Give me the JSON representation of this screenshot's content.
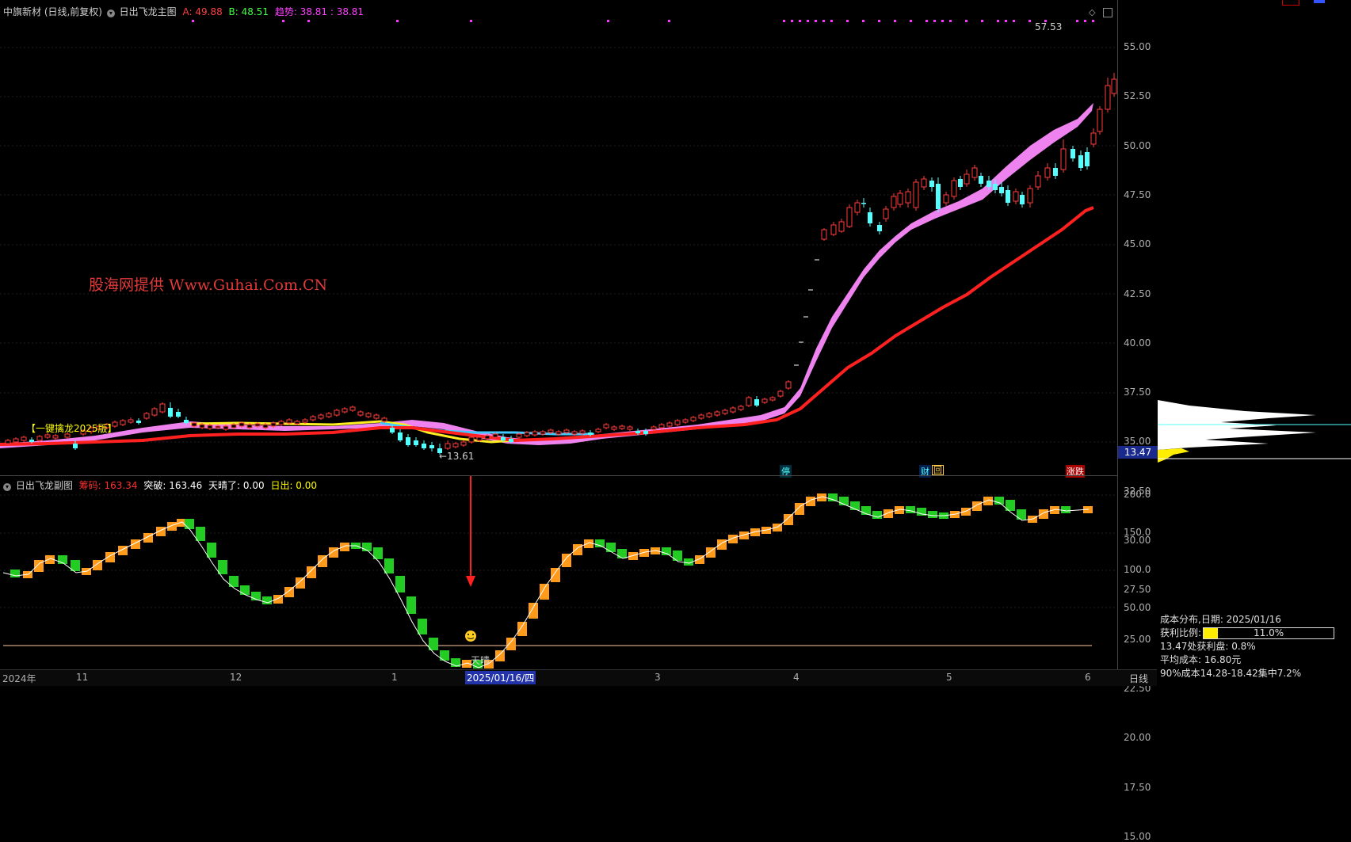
{
  "main_header": {
    "stock": "中旗新材 (日线,前复权)",
    "indicator": "日出飞龙主图",
    "a_label": "A: 49.88",
    "b_label": "B: 48.51",
    "trend_label": "趋势: 38.81 : 38.81"
  },
  "sub_header": {
    "indicator": "日出飞龙副图",
    "chouma": "筹码: 163.34",
    "tupo": "突破: 163.46",
    "tianqing": "天晴了: 0.00",
    "richu": "日出: 0.00"
  },
  "watermark": "股海网提供 Www.Guhai.Com.CN",
  "yellow_label": "【一键擒龙2025版】",
  "high_label": "57.53",
  "low_label": "←13.61",
  "sun_label": "天晴",
  "current_price": "13.47",
  "main_y_ticks": [
    "55.00",
    "52.50",
    "50.00",
    "47.50",
    "45.00",
    "42.50",
    "40.00",
    "37.50",
    "35.00",
    "32.50",
    "30.00",
    "27.50",
    "25.00",
    "22.50",
    "20.00",
    "17.50",
    "15.00"
  ],
  "sub_y_ticks": [
    "200.0",
    "150.0",
    "100.0",
    "50.00"
  ],
  "x_labels": [
    "2024年",
    "11",
    "12",
    "1",
    "2025/01/16/四",
    "3",
    "4",
    "5",
    "6"
  ],
  "period": "日线",
  "event_badges": [
    "停",
    "财",
    "回",
    "涨跌"
  ],
  "cost_panel": {
    "title": "成本分布,日期: 2025/01/16",
    "profit_label": "获利比例:",
    "profit_value": "11.0%",
    "profit_ratio": 0.11,
    "line2": "13.47处获利盘: 0.8%",
    "line3": "平均成本: 16.80元",
    "line4": "90%成本14.28-18.42集中7.2%"
  },
  "colors": {
    "up": "#ff3c3c",
    "down": "#54ffff",
    "ribbon": "#ee82ee",
    "ma_red": "#ff2020",
    "orange": "#ff9a1a",
    "green": "#22cc22"
  }
}
